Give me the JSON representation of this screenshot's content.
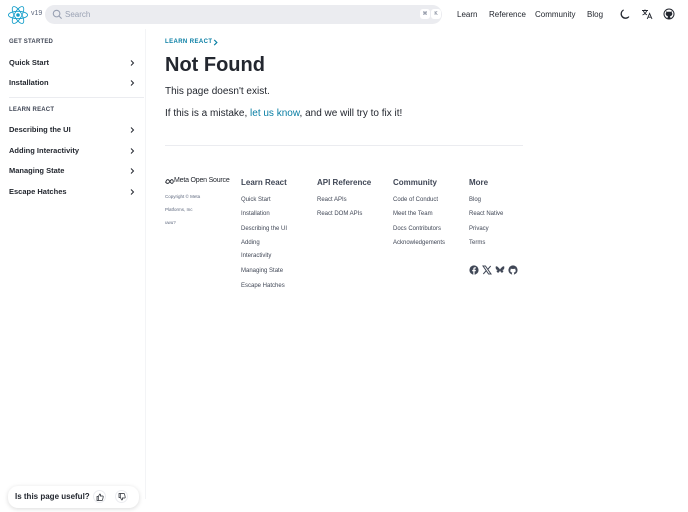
{
  "header": {
    "version": "v19",
    "search_placeholder": "Search",
    "kbd": [
      "⌘",
      "K"
    ],
    "nav": [
      "Learn",
      "Reference",
      "Community",
      "Blog"
    ]
  },
  "sidebar": {
    "section1": "GET STARTED",
    "section1_items": [
      "Quick Start",
      "Installation"
    ],
    "section2": "LEARN REACT",
    "section2_items": [
      "Describing the UI",
      "Adding Interactivity",
      "Managing State",
      "Escape Hatches"
    ]
  },
  "main": {
    "breadcrumb": "LEARN REACT",
    "title": "Not Found",
    "p1": "This page doesn't exist.",
    "p2_before": "If this is a mistake, ",
    "p2_link": "let us know",
    "p2_after": ", and we will try to fix it!"
  },
  "footer": {
    "brand": "Meta Open Source",
    "copyright_lines": [
      "Copyright © Meta",
      "Platforms, Inc",
      "uwu?"
    ],
    "columns": [
      {
        "title": "Learn React",
        "links": [
          "Quick Start",
          "Installation",
          "Describing the UI",
          "Adding",
          "Interactivity",
          "Managing State",
          "Escape Hatches"
        ]
      },
      {
        "title": "API Reference",
        "links": [
          "React APIs",
          "React DOM APIs"
        ]
      },
      {
        "title": "Community",
        "links": [
          "Code of Conduct",
          "Meet the Team",
          "Docs Contributors",
          "Acknowledgements"
        ]
      },
      {
        "title": "More",
        "links": [
          "Blog",
          "React Native",
          "Privacy",
          "Terms"
        ]
      }
    ],
    "social_icons": [
      "facebook-icon",
      "x-icon",
      "bluesky-icon",
      "github-icon"
    ]
  },
  "feedback": {
    "question": "Is this page useful?"
  },
  "colors": {
    "accent": "#087ea4",
    "text": "#23272f",
    "search_bg": "#ebecf0"
  }
}
